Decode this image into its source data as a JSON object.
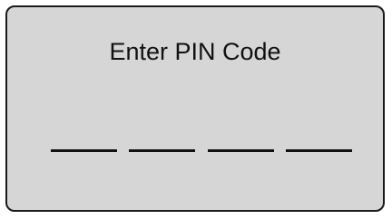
{
  "screen": {
    "title": "Enter PIN Code",
    "background_color": "#d6d6d6",
    "border_color": "#1a1a1a"
  },
  "pin": {
    "slot_count": 4,
    "entered_digits": ""
  }
}
